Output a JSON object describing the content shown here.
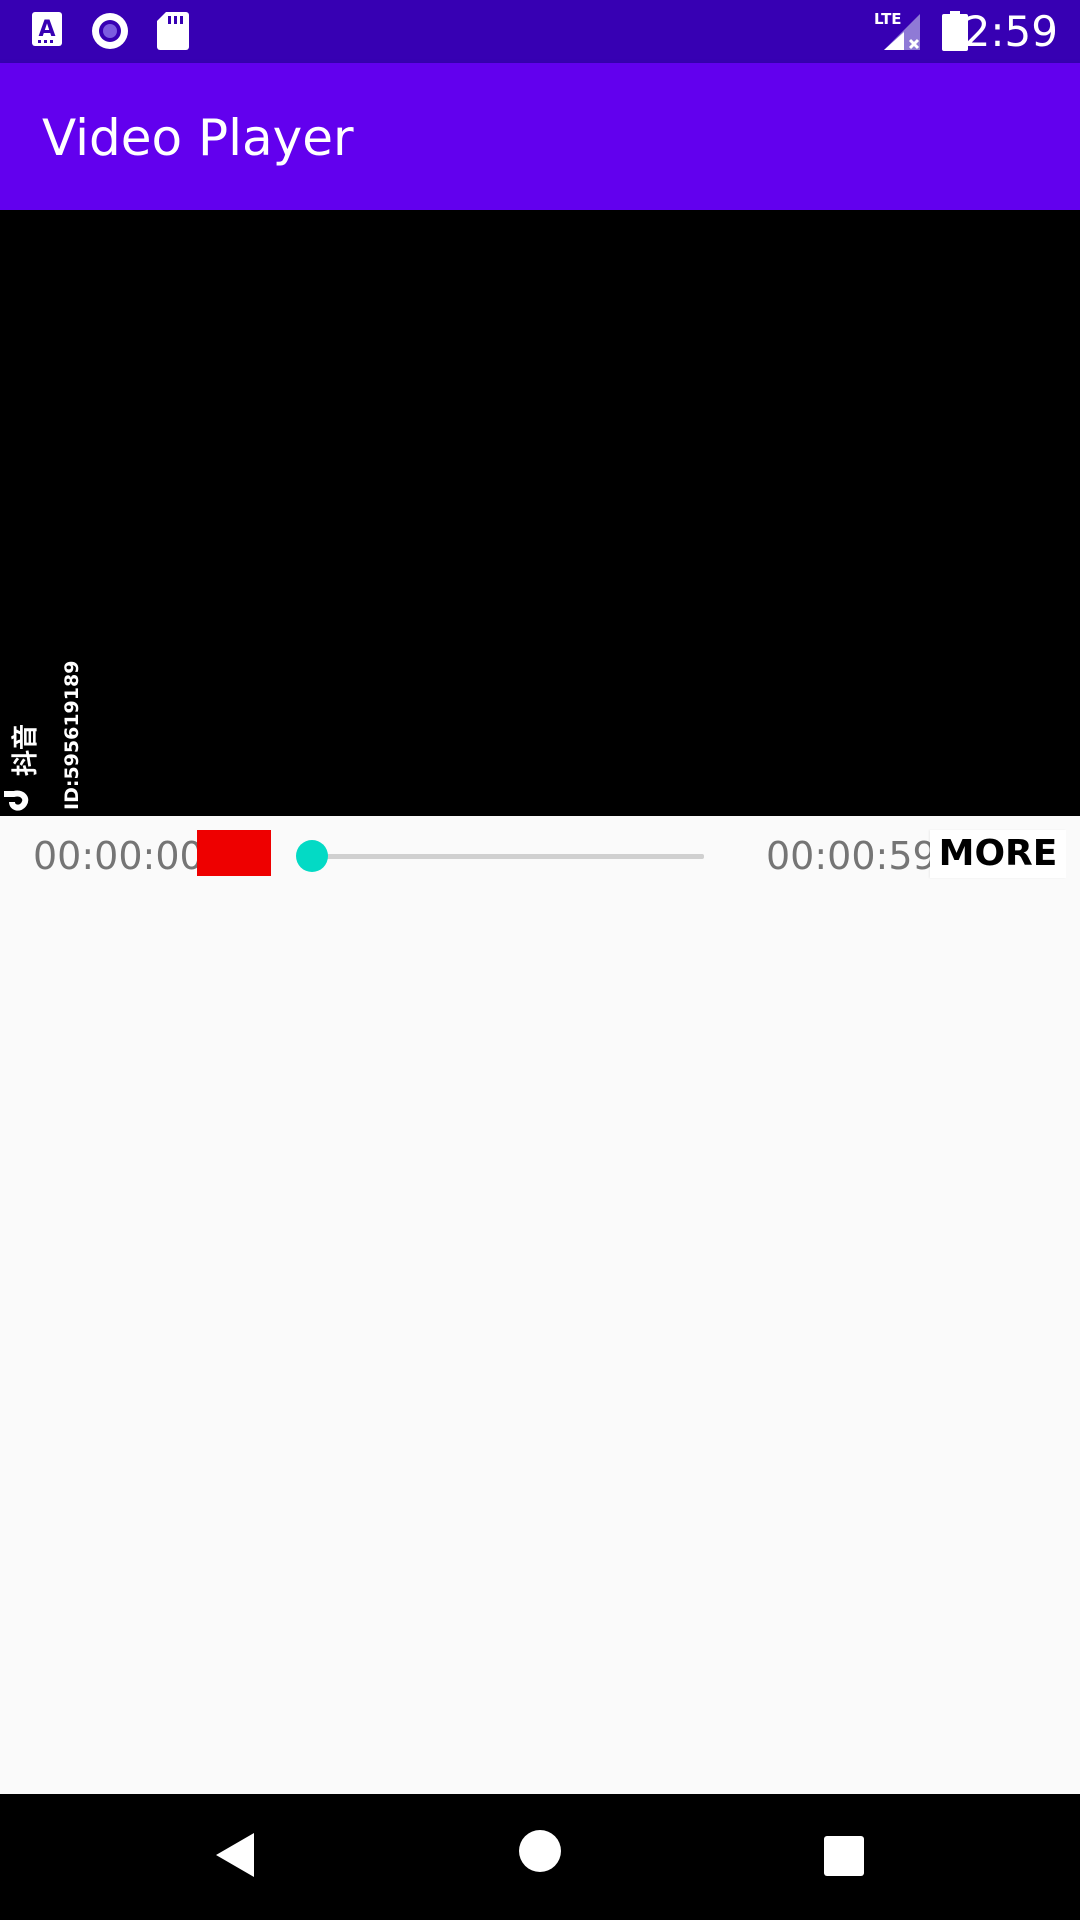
{
  "status_bar": {
    "time": "2:59",
    "network_label": "LTE",
    "icons": [
      "a-notification-icon",
      "radio-record-icon",
      "sd-card-icon",
      "lte-signal-icon",
      "battery-icon"
    ]
  },
  "app_bar": {
    "title": "Video Player"
  },
  "video": {
    "watermark_text": "ID:595619189",
    "watermark_brand": "抖音"
  },
  "controls": {
    "current_time": "00:00:00",
    "total_time": "00:00:59",
    "more_label": "MORE",
    "record_color": "#ee0000",
    "seek_progress": 0.0,
    "seek_color": "#03dac5"
  },
  "nav_bar": {
    "icons": [
      "back-icon",
      "home-icon",
      "recents-icon"
    ]
  },
  "colors": {
    "status_bar": "#3700b3",
    "app_bar": "#6200ee",
    "background": "#fafafa",
    "accent": "#03dac5"
  }
}
